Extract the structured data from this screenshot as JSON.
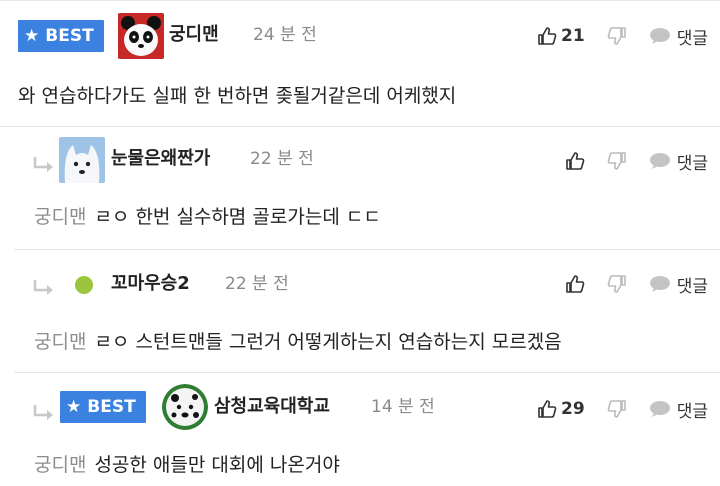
{
  "best_label": "BEST",
  "reply_label": "댓글",
  "comments": [
    {
      "nick": "궁디맨",
      "time": "24 분 전",
      "likes": "21",
      "text": "와 연습하다가도 실패 한 번하면 좆될거같은데 어케했지"
    },
    {
      "nick": "눈물은왜짠가",
      "time": "22 분 전",
      "mention": "궁디맨",
      "text": "ㄹㅇ 한번 실수하몀 골로가는데 ㄷㄷ"
    },
    {
      "nick": "꼬마우승2",
      "time": "22 분 전",
      "mention": "궁디맨",
      "text": "ㄹㅇ 스턴트맨들 그런거 어떻게하는지 연습하는지 모르겠음"
    },
    {
      "nick": "삼청교육대학교",
      "time": "14 분 전",
      "likes": "29",
      "mention": "궁디맨",
      "text": "성공한 애들만 대회에 나온거야"
    }
  ],
  "colors": {
    "best_bg": "#3b82e0",
    "muted": "#8c8c8c"
  }
}
